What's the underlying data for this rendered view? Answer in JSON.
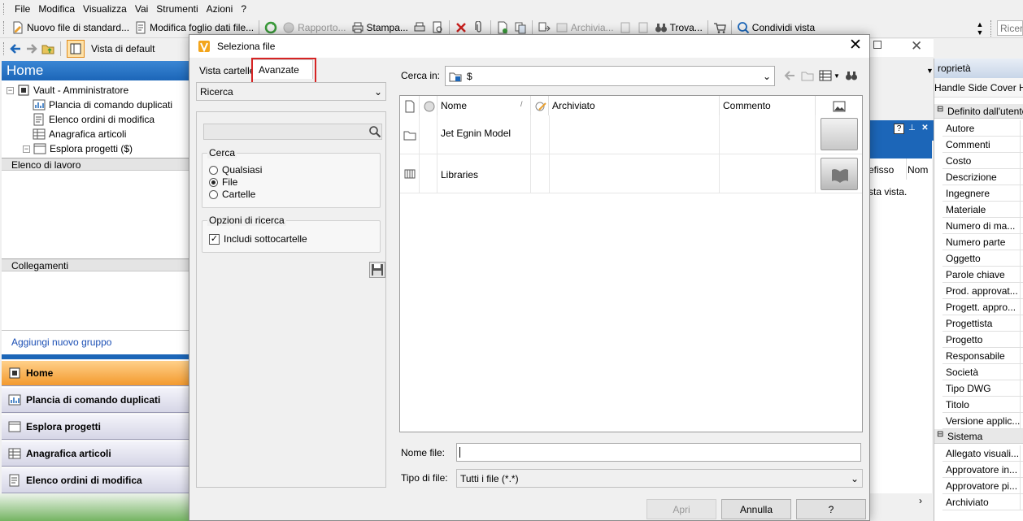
{
  "menu": [
    "File",
    "Modifica",
    "Visualizza",
    "Vai",
    "Strumenti",
    "Azioni",
    "?"
  ],
  "toolbar": {
    "new_file": "Nuovo file di standard...",
    "edit_sheet": "Modifica foglio dati file...",
    "report": "Rapporto...",
    "print": "Stampa...",
    "archive": "Archivia...",
    "find": "Trova...",
    "share_view": "Condividi vista",
    "search_placeholder": "Ricerc"
  },
  "navbar": {
    "view_label": "Vista di default"
  },
  "left": {
    "home_title": "Home",
    "tree": {
      "root": "Vault - Amministratore",
      "items": [
        "Plancia di comando duplicati",
        "Elenco ordini di modifica",
        "Anagrafica articoli",
        "Esplora progetti ($)"
      ]
    },
    "worklist": "Elenco di lavoro",
    "links": "Collegamenti",
    "add_group": "Aggiungi nuovo gruppo",
    "nav_buttons": [
      "Home",
      "Plancia di comando duplicati",
      "Esplora progetti",
      "Anagrafica articoli",
      "Elenco ordini di modifica"
    ]
  },
  "bg_window": {
    "col1": "efisso",
    "col2": "Nom",
    "msg": "sta vista."
  },
  "properties": {
    "title": "roprietà",
    "file_name": "Handle Side Cover H...",
    "group_user": "Definito dall'utente",
    "user_rows": [
      "Autore",
      "Commenti",
      "Costo",
      "Descrizione",
      "Ingegnere",
      "Materiale",
      "Numero di ma...",
      "Numero parte",
      "Oggetto",
      "Parole chiave",
      "Prod. approvat...",
      "Progett. appro...",
      "Progettista",
      "Progetto",
      "Responsabile",
      "Società",
      "Tipo DWG",
      "Titolo",
      "Versione applic..."
    ],
    "group_system": "Sistema",
    "system_rows": [
      "Allegato visuali...",
      "Approvatore in...",
      "Approvatore pi...",
      "Archiviato"
    ]
  },
  "dialog": {
    "title": "Seleziona file",
    "tabs": {
      "folders": "Vista cartelle",
      "advanced": "Avanzate"
    },
    "search_combo": "Ricerca",
    "search_group": {
      "legend": "Cerca",
      "options": [
        "Qualsiasi",
        "File",
        "Cartelle"
      ],
      "selected": "File"
    },
    "options_group": {
      "legend": "Opzioni di ricerca",
      "subfolders": "Includi sottocartelle",
      "subfolders_checked": true
    },
    "look_in_label": "Cerca in:",
    "look_in_value": "$",
    "columns": {
      "name": "Nome",
      "archived": "Archiviato",
      "comment": "Commento"
    },
    "files": [
      {
        "name": "Jet Egnin Model",
        "icon": "folder-icon",
        "archived": "",
        "comment": ""
      },
      {
        "name": "Libraries",
        "icon": "library-icon",
        "archived": "",
        "comment": ""
      }
    ],
    "file_name_label": "Nome file:",
    "file_name_value": "",
    "file_type_label": "Tipo di file:",
    "file_type_value": "Tutti i file (*.*)",
    "buttons": {
      "open": "Apri",
      "cancel": "Annulla",
      "help": "?"
    }
  },
  "colors": {
    "accent_blue": "#1c66b8",
    "highlight_red": "#d62424",
    "active_nav": "#f39a2e"
  }
}
